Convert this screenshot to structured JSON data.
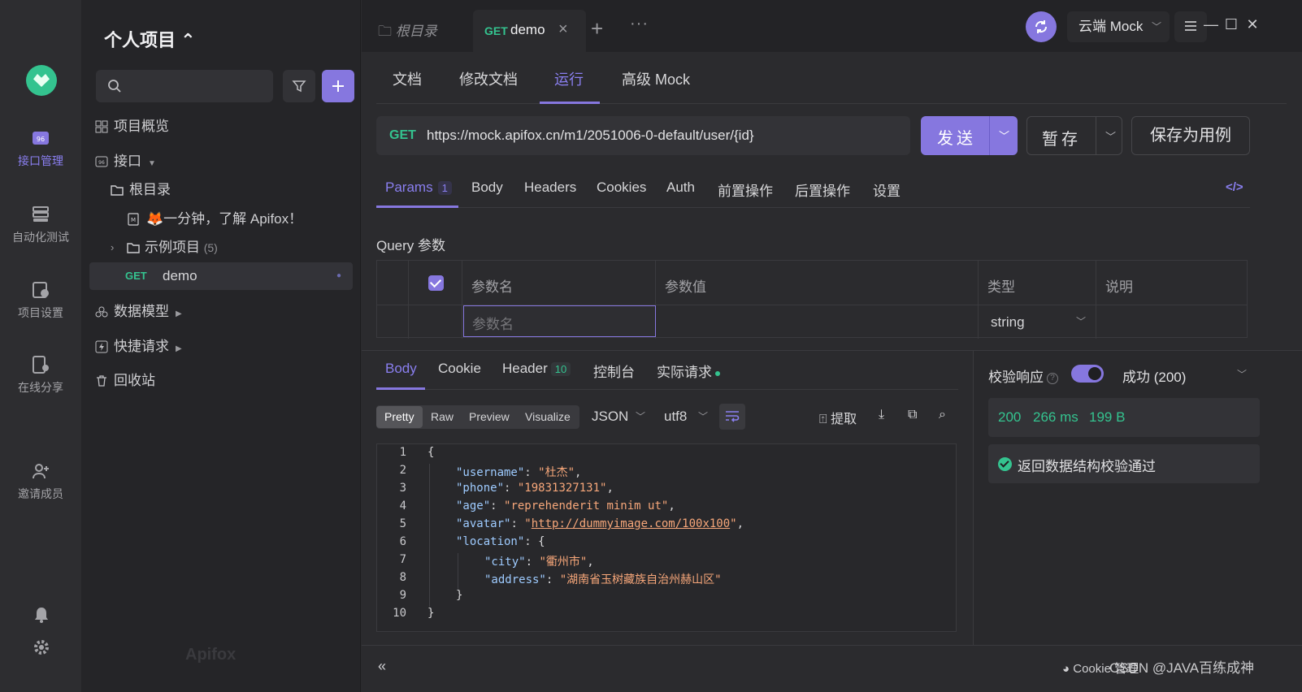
{
  "rail": {
    "items": [
      {
        "label": "接口管理",
        "icon": "api-icon",
        "active": true
      },
      {
        "label": "自动化测试",
        "icon": "automation-icon",
        "active": false
      },
      {
        "label": "项目设置",
        "icon": "project-settings-icon",
        "active": false
      },
      {
        "label": "在线分享",
        "icon": "share-icon",
        "active": false
      },
      {
        "label": "邀请成员",
        "icon": "invite-icon",
        "active": false
      }
    ]
  },
  "sidebar": {
    "project_title": "个人项目 ⌃",
    "search_placeholder": "",
    "items": {
      "overview": "项目概览",
      "api": "接口",
      "root": "根目录",
      "intro": "🦊一分钟，了解 Apifox！",
      "example": "示例项目",
      "example_count": "(5)",
      "demo_method": "GET",
      "demo_name": "demo",
      "models": "数据模型",
      "quick": "快捷请求",
      "trash": "回收站"
    },
    "watermark": "Apifox"
  },
  "topbar": {
    "tab_root": "根目录",
    "tab_method": "GET",
    "tab_name": "demo",
    "tab_plus": "+",
    "tab_more": "···",
    "env_label": "云端 Mock"
  },
  "subtabs": [
    "文档",
    "修改文档",
    "运行",
    "高级 Mock"
  ],
  "request": {
    "method": "GET",
    "url": "https://mock.apifox.cn/m1/2051006-0-default/user/{id}",
    "send_label": "发送",
    "save_label": "暂存",
    "save_case_label": "保存为用例"
  },
  "param_tabs": {
    "params": "Params",
    "params_count": "1",
    "items": [
      "Body",
      "Headers",
      "Cookies",
      "Auth",
      "前置操作",
      "后置操作",
      "设置"
    ],
    "code_label": "</>"
  },
  "query": {
    "title": "Query 参数",
    "headers": [
      "参数名",
      "参数值",
      "类型",
      "说明"
    ],
    "name_placeholder": "参数名",
    "type_value": "string"
  },
  "response": {
    "tabs": {
      "body": "Body",
      "cookie": "Cookie",
      "header": "Header",
      "header_count": "10",
      "console": "控制台",
      "actual": "实际请求"
    },
    "formats": [
      "Pretty",
      "Raw",
      "Preview",
      "Visualize"
    ],
    "lang": "JSON",
    "encoding": "utf8",
    "extract_label": "提取",
    "code_lines": [
      {
        "n": "1",
        "indent": 0,
        "parts": [
          {
            "t": "{",
            "c": ""
          }
        ]
      },
      {
        "n": "2",
        "indent": 1,
        "parts": [
          {
            "t": "\"username\"",
            "c": "k"
          },
          {
            "t": ": ",
            "c": ""
          },
          {
            "t": "\"杜杰\"",
            "c": "s"
          },
          {
            "t": ",",
            "c": ""
          }
        ]
      },
      {
        "n": "3",
        "indent": 1,
        "parts": [
          {
            "t": "\"phone\"",
            "c": "k"
          },
          {
            "t": ": ",
            "c": ""
          },
          {
            "t": "\"19831327131\"",
            "c": "s"
          },
          {
            "t": ",",
            "c": ""
          }
        ]
      },
      {
        "n": "4",
        "indent": 1,
        "parts": [
          {
            "t": "\"age\"",
            "c": "k"
          },
          {
            "t": ": ",
            "c": ""
          },
          {
            "t": "\"reprehenderit minim ut\"",
            "c": "s"
          },
          {
            "t": ",",
            "c": ""
          }
        ]
      },
      {
        "n": "5",
        "indent": 1,
        "parts": [
          {
            "t": "\"avatar\"",
            "c": "k"
          },
          {
            "t": ": ",
            "c": ""
          },
          {
            "t": "\"",
            "c": "s"
          },
          {
            "t": "http://dummyimage.com/100x100",
            "c": "su"
          },
          {
            "t": "\"",
            "c": "s"
          },
          {
            "t": ",",
            "c": ""
          }
        ]
      },
      {
        "n": "6",
        "indent": 1,
        "parts": [
          {
            "t": "\"location\"",
            "c": "k"
          },
          {
            "t": ": {",
            "c": ""
          }
        ]
      },
      {
        "n": "7",
        "indent": 2,
        "parts": [
          {
            "t": "\"city\"",
            "c": "k"
          },
          {
            "t": ": ",
            "c": ""
          },
          {
            "t": "\"衢州市\"",
            "c": "s"
          },
          {
            "t": ",",
            "c": ""
          }
        ]
      },
      {
        "n": "8",
        "indent": 2,
        "parts": [
          {
            "t": "\"address\"",
            "c": "k"
          },
          {
            "t": ": ",
            "c": ""
          },
          {
            "t": "\"湖南省玉树藏族自治州赫山区\"",
            "c": "s"
          }
        ]
      },
      {
        "n": "9",
        "indent": 1,
        "parts": [
          {
            "t": "}",
            "c": ""
          }
        ]
      },
      {
        "n": "10",
        "indent": 0,
        "parts": [
          {
            "t": "}",
            "c": ""
          }
        ]
      }
    ]
  },
  "validation": {
    "title": "校验响应",
    "status": "成功 (200)",
    "code": "200",
    "time": "266 ms",
    "size": "199 B",
    "result": "返回数据结构校验通过"
  },
  "statusbar": {
    "collapse": "«",
    "cookie": "Cookie 管理",
    "watermark": "CSDN @JAVA百练成神"
  },
  "colors": {
    "accent": "#8677df",
    "success": "#34c38f",
    "string": "#f7a77a",
    "key": "#9ecbff"
  }
}
